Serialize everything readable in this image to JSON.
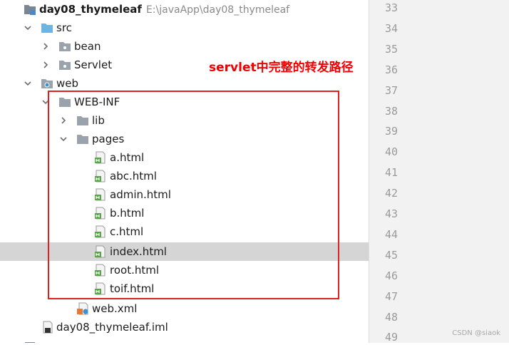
{
  "project": {
    "name": "day08_thymeleaf",
    "path": "E:\\javaApp\\day08_thymeleaf"
  },
  "tree": {
    "src": "src",
    "bean": "bean",
    "servlet": "Servlet",
    "web": "web",
    "webinf": "WEB-INF",
    "lib": "lib",
    "pages": "pages",
    "files": [
      "a.html",
      "abc.html",
      "admin.html",
      "b.html",
      "c.html",
      "index.html",
      "root.html",
      "toif.html"
    ],
    "webxml": "web.xml",
    "iml": "day08_thymeleaf.iml"
  },
  "annotation": "servlet中完整的转发路径",
  "line_numbers": [
    "33",
    "34",
    "35",
    "36",
    "37",
    "38",
    "39",
    "40",
    "41",
    "42",
    "43",
    "44",
    "45",
    "46",
    "47",
    "48",
    "49"
  ],
  "watermark": "CSDN @siaok",
  "colors": {
    "selection": "#d5d5d5",
    "annotation_red": "#f00000",
    "box_red": "#e02020"
  }
}
